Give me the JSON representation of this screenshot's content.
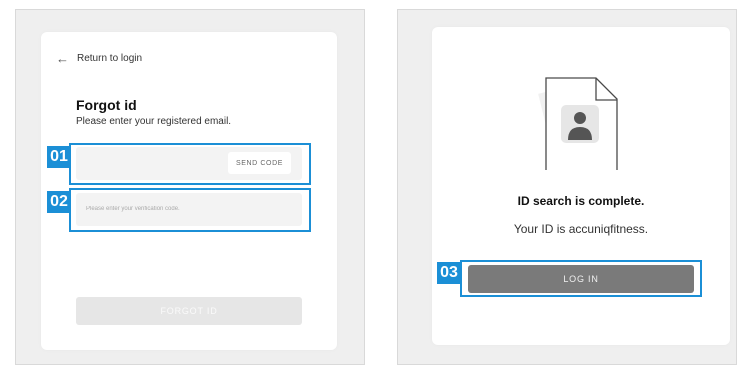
{
  "left_screen": {
    "back_link": "Return to login",
    "title": "Forgot id",
    "subtitle": "Please enter your registered email.",
    "email_field": {
      "value": "",
      "placeholder": ""
    },
    "send_code_label": "SEND CODE",
    "verification_field": {
      "value": "",
      "placeholder": "Please enter your verification code."
    },
    "forgot_button_label": "FORGOT ID"
  },
  "right_screen": {
    "illustration_icon": "profile-document-icon",
    "result_title": "ID search is complete.",
    "result_text": "Your ID is accuniqfitness.",
    "login_button_label": "LOG IN"
  },
  "annotations": {
    "tag_01": "01",
    "tag_02": "02",
    "tag_03": "03",
    "highlight_color": "#1b8fd6"
  }
}
